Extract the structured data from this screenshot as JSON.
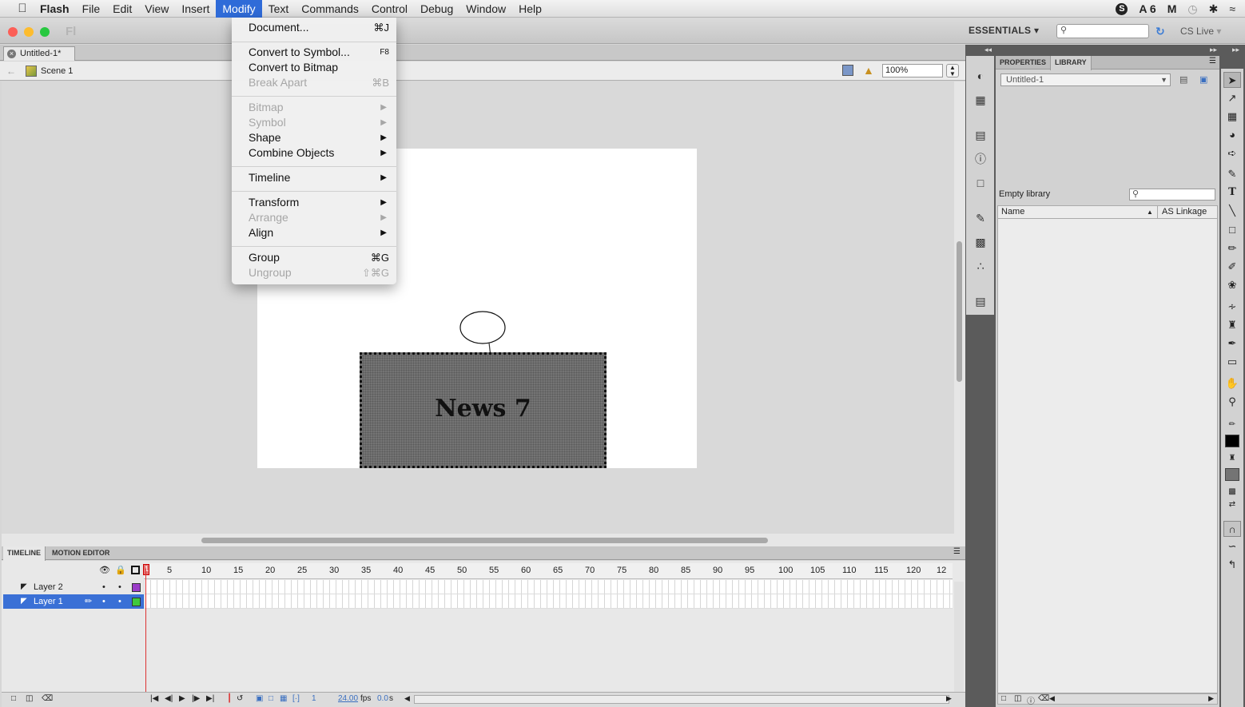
{
  "menubar": {
    "app_name": "Flash",
    "items": [
      "File",
      "Edit",
      "View",
      "Insert",
      "Modify",
      "Text",
      "Commands",
      "Control",
      "Debug",
      "Window",
      "Help"
    ],
    "status": {
      "adobe_badge": "6"
    }
  },
  "appbar": {
    "workspace": "ESSENTIALS",
    "cs_live": "CS Live",
    "logo": "Fl"
  },
  "document": {
    "tab_title": "Untitled-1*",
    "scene": "Scene 1",
    "zoom": "100%"
  },
  "modify_menu": {
    "items": [
      {
        "label": "Document...",
        "shortcut": "⌘J",
        "enabled": true
      },
      {
        "label": "Convert to Symbol...",
        "shortcut": "F8",
        "enabled": true
      },
      {
        "label": "Convert to Bitmap",
        "shortcut": "",
        "enabled": true
      },
      {
        "label": "Break Apart",
        "shortcut": "⌘B",
        "enabled": false
      },
      {
        "label": "Bitmap",
        "submenu": true,
        "enabled": false
      },
      {
        "label": "Symbol",
        "submenu": true,
        "enabled": false
      },
      {
        "label": "Shape",
        "submenu": true,
        "enabled": true
      },
      {
        "label": "Combine Objects",
        "submenu": true,
        "enabled": true
      },
      {
        "label": "Timeline",
        "submenu": true,
        "enabled": true
      },
      {
        "label": "Transform",
        "submenu": true,
        "enabled": true
      },
      {
        "label": "Arrange",
        "submenu": true,
        "enabled": false
      },
      {
        "label": "Align",
        "submenu": true,
        "enabled": true
      },
      {
        "label": "Group",
        "shortcut": "⌘G",
        "enabled": true
      },
      {
        "label": "Ungroup",
        "shortcut": "⇧⌘G",
        "enabled": false
      }
    ]
  },
  "stage": {
    "news_text": "News 7"
  },
  "library_panel": {
    "tabs": [
      "PROPERTIES",
      "LIBRARY"
    ],
    "document": "Untitled-1",
    "empty_label": "Empty library",
    "columns": [
      "Name",
      "AS Linkage"
    ]
  },
  "timeline": {
    "tabs": [
      "TIMELINE",
      "MOTION EDITOR"
    ],
    "layers": [
      {
        "name": "Layer 2",
        "selected": false,
        "color": "#9b3cc9"
      },
      {
        "name": "Layer 1",
        "selected": true,
        "color": "#3ec93e"
      }
    ],
    "ruler": [
      "1",
      "5",
      "10",
      "15",
      "20",
      "25",
      "30",
      "35",
      "40",
      "45",
      "50",
      "55",
      "60",
      "65",
      "70",
      "75",
      "80",
      "85",
      "90",
      "95",
      "100",
      "105",
      "110",
      "115",
      "120",
      "12"
    ],
    "status": {
      "frame": "1",
      "fps": "24.00",
      "fps_unit": "fps",
      "time": "0.0",
      "time_unit": "s"
    }
  }
}
